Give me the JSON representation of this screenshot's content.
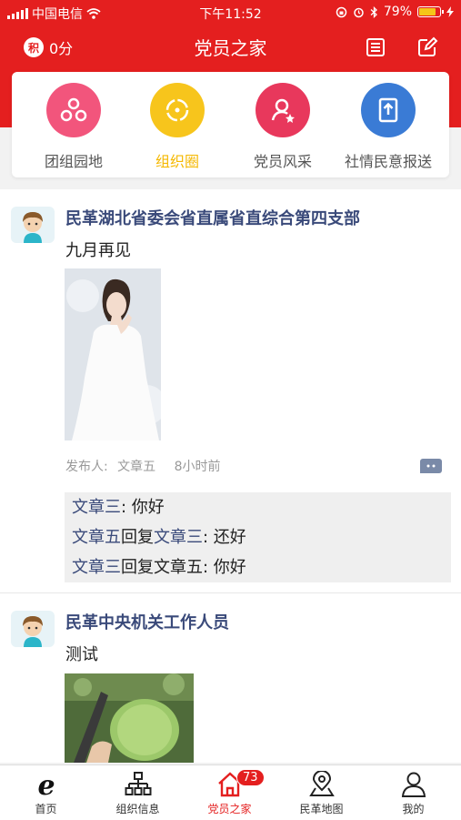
{
  "status_bar": {
    "carrier": "中国电信",
    "time": "下午11:52",
    "battery": "79%"
  },
  "navbar": {
    "score": "0分",
    "score_icon_char": "积",
    "title": "党员之家"
  },
  "categories": [
    {
      "label": "团组园地",
      "icon": "circles-icon",
      "color": "#f2557c",
      "active": false
    },
    {
      "label": "组织圈",
      "icon": "target-icon",
      "color": "#f7c51c",
      "active": true
    },
    {
      "label": "党员风采",
      "icon": "person-icon",
      "color": "#e8385c",
      "active": false
    },
    {
      "label": "社情民意报送",
      "icon": "upload-doc-icon",
      "color": "#3a7bd5",
      "active": false
    }
  ],
  "posts": [
    {
      "author": "民革湖北省委会省直属省直综合第四支部",
      "text": "九月再见",
      "publisher_label": "发布人:",
      "publisher": "文章五",
      "time": "8小时前",
      "comments": [
        {
          "from": "文章三",
          "sep": ": ",
          "content": "你好"
        },
        {
          "from": "文章五",
          "reply": "回复",
          "to": "文章三",
          "sep": ": ",
          "content": "还好"
        },
        {
          "from": "文章三",
          "reply": "回复",
          "to": "文章五",
          "sep": ": ",
          "content": "你好"
        }
      ]
    },
    {
      "author": "民革中央机关工作人员",
      "text": "测试"
    }
  ],
  "tabs": [
    {
      "label": "首页",
      "icon": "e-logo-icon"
    },
    {
      "label": "组织信息",
      "icon": "org-chart-icon"
    },
    {
      "label": "党员之家",
      "icon": "home-icon",
      "badge": "73",
      "active": true
    },
    {
      "label": "民革地图",
      "icon": "map-pin-icon"
    },
    {
      "label": "我的",
      "icon": "user-icon"
    }
  ],
  "colors": {
    "brand_red": "#e41f1f",
    "name_blue": "#3a4a7a"
  }
}
